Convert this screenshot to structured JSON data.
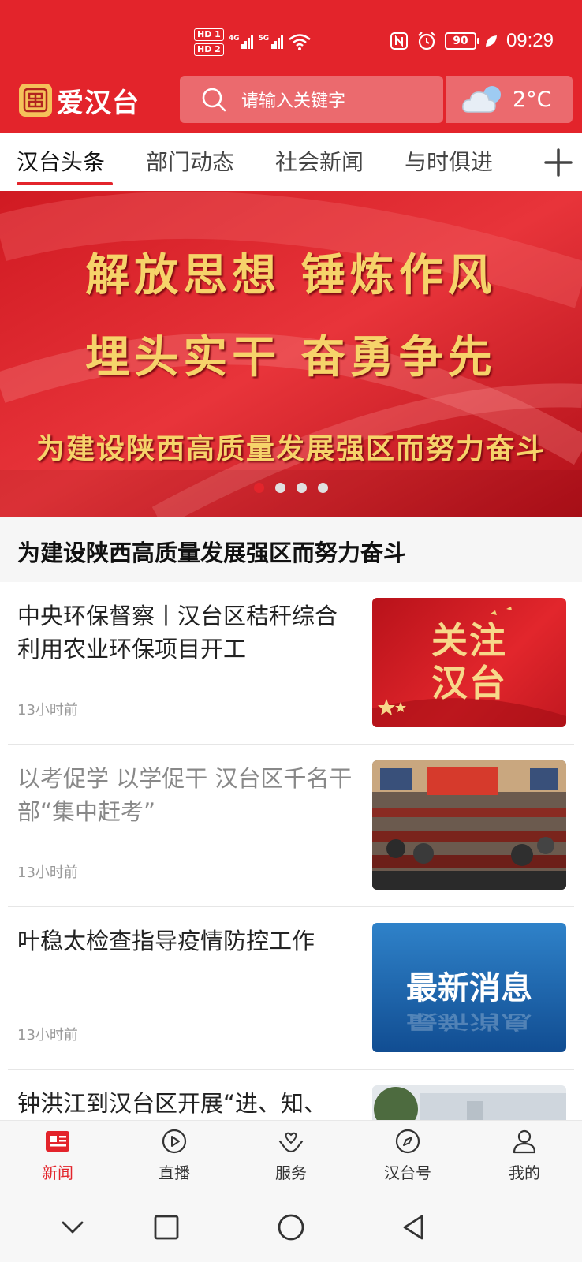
{
  "status_bar": {
    "sim1_badge": "HD 1",
    "sim2_badge": "HD 2",
    "net1": "4G",
    "net2": "5G",
    "battery": "90",
    "time": "09:29"
  },
  "app": {
    "name": "爱汉台",
    "search_placeholder": "请输入关键字",
    "temperature": "2°C"
  },
  "tabs": [
    "汉台头条",
    "部门动态",
    "社会新闻",
    "与时俱进"
  ],
  "banner": {
    "line1": "解放思想 锤炼作风",
    "line2": "埋头实干 奋勇争先",
    "line3": "为建设陕西高质量发展强区而努力奋斗",
    "caption": "为建设陕西高质量发展强区而努力奋斗",
    "slide_count": 4,
    "active_slide": 1
  },
  "news": [
    {
      "title": "中央环保督察丨汉台区秸秆综合利用农业环保项目开工",
      "time": "13小时前",
      "thumb_line1": "关注",
      "thumb_line2": "汉台"
    },
    {
      "title": "以考促学 以学促干 汉台区千名干部“集中赶考”",
      "time": "13小时前"
    },
    {
      "title": "叶稳太检查指导疫情防控工作",
      "time": "13小时前",
      "thumb_text": "最新消息"
    },
    {
      "title": "钟洪江到汉台区开展“进、知、"
    }
  ],
  "bottom_nav": {
    "news": "新闻",
    "live": "直播",
    "service": "服务",
    "hantai": "汉台号",
    "mine": "我的"
  },
  "colors": {
    "brand_red": "#e3242b",
    "banner_gold": "#f6d36a"
  }
}
